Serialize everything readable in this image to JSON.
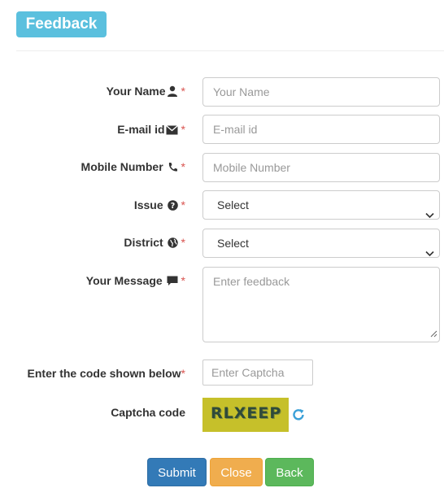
{
  "header": {
    "title": "Feedback"
  },
  "form": {
    "name": {
      "label": "Your Name",
      "placeholder": "Your Name",
      "icon": "user-icon"
    },
    "email": {
      "label": "E-mail id",
      "placeholder": "E-mail id",
      "icon": "envelope-icon"
    },
    "mobile": {
      "label": "Mobile Number",
      "placeholder": "Mobile Number",
      "icon": "phone-icon"
    },
    "issue": {
      "label": "Issue",
      "selected": "Select",
      "icon": "question-circle-icon"
    },
    "district": {
      "label": "District",
      "selected": "Select",
      "icon": "globe-icon"
    },
    "message": {
      "label": "Your Message",
      "placeholder": "Enter feedback",
      "icon": "comment-icon"
    },
    "required_mark": "*",
    "captcha_entry": {
      "label": "Enter the code shown below",
      "placeholder": "Enter Captcha"
    },
    "captcha_code": {
      "label": "Captcha code",
      "value": "RLXEEP",
      "refresh_icon": "refresh-icon"
    }
  },
  "buttons": {
    "submit": "Submit",
    "close": "Close",
    "back": "Back"
  },
  "colors": {
    "header": "#5bc0de",
    "submit": "#337ab7",
    "close": "#f0ad4e",
    "back": "#5cb85c",
    "required": "#d9534f",
    "captcha_bg": "#c6c02a"
  }
}
